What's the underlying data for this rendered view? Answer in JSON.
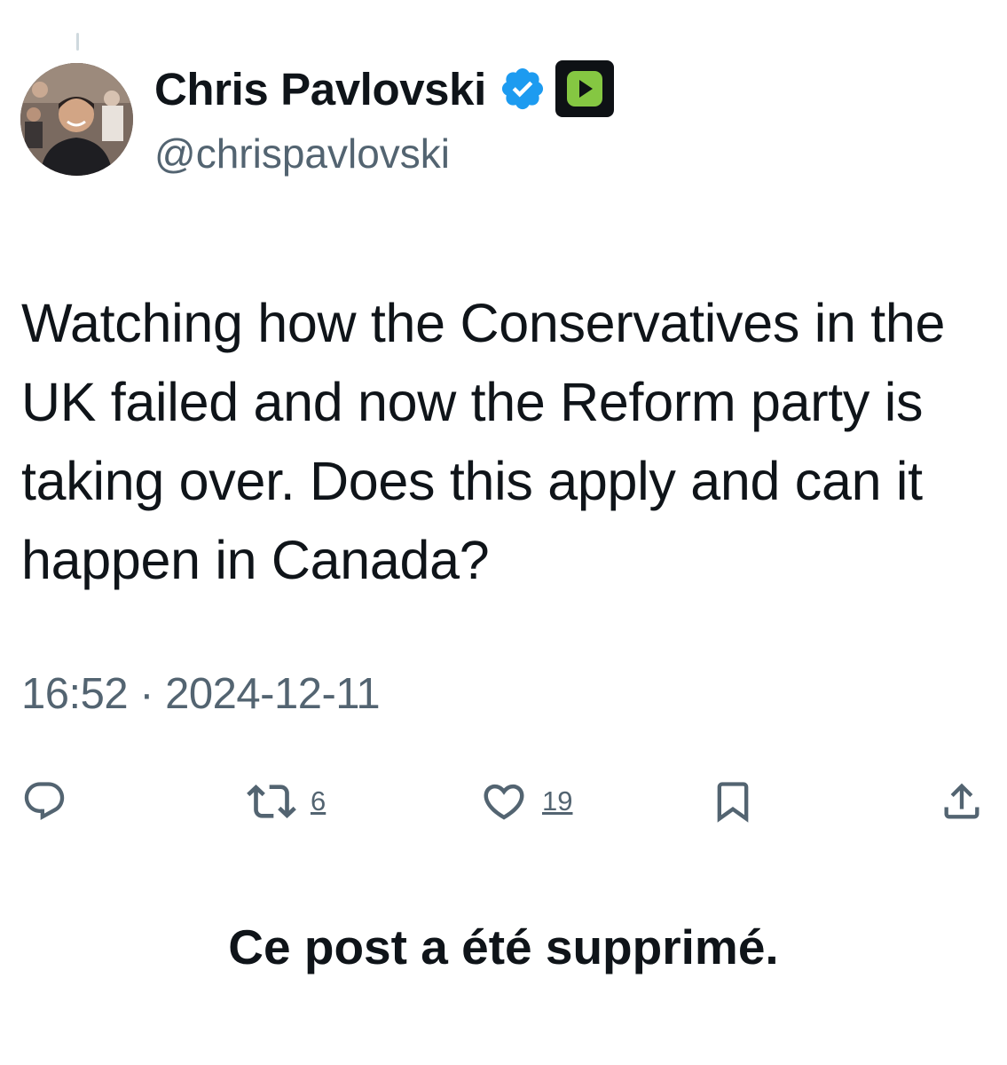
{
  "author": {
    "display_name": "Chris Pavlovski",
    "handle": "@chrispavlovski",
    "verified_badge_color": "#1d9bf0",
    "app_badge_color": "#85c742"
  },
  "tweet": {
    "text": "Watching how the Conservatives in the UK failed and now the Reform party is taking over. Does this apply and can it happen in Canada?",
    "timestamp": "16:52 · 2024-12-11"
  },
  "actions": {
    "reply": {
      "icon": "reply-icon"
    },
    "retweet": {
      "icon": "retweet-icon",
      "count": "6"
    },
    "like": {
      "icon": "heart-icon",
      "count": "19"
    },
    "bookmark": {
      "icon": "bookmark-icon"
    },
    "share": {
      "icon": "share-icon"
    }
  },
  "notice": "Ce post a été supprimé."
}
